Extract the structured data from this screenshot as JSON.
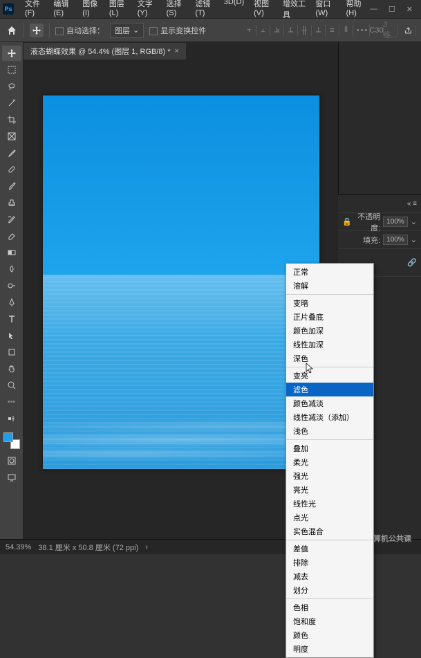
{
  "app": {
    "logo": "Ps"
  },
  "menu": [
    "文件(F)",
    "编辑(E)",
    "图像(I)",
    "图层(L)",
    "文字(Y)",
    "选择(S)",
    "滤镜(T)",
    "3D(D)",
    "视图(V)",
    "增效工具",
    "窗口(W)",
    "帮助(H)"
  ],
  "options": {
    "autoSelectLabel": "自动选择：",
    "targetDropdown": "图层",
    "showTransformLabel": "显示变换控件",
    "c30": "C30",
    "c30extra": "3维..."
  },
  "document": {
    "tabTitle": "液态蝴蝶效果 @ 54.4% (图层 1, RGB/8) *"
  },
  "panels": {
    "opacityLabel": "不透明度:",
    "opacityValue": "100%",
    "fillLabel": "填充:",
    "fillValue": "100%"
  },
  "blendModes": {
    "group1": [
      "正常",
      "溶解"
    ],
    "group2": [
      "变暗",
      "正片叠底",
      "颜色加深",
      "线性加深",
      "深色"
    ],
    "group3": [
      "变亮",
      "滤色",
      "颜色减淡",
      "线性减淡（添加）",
      "浅色"
    ],
    "group4": [
      "叠加",
      "柔光",
      "强光",
      "亮光",
      "线性光",
      "点光",
      "实色混合"
    ],
    "group5": [
      "差值",
      "排除",
      "减去",
      "划分"
    ],
    "group6": [
      "色相",
      "饱和度",
      "颜色",
      "明度"
    ],
    "highlighted": "滤色"
  },
  "status": {
    "zoom": "54.39%",
    "dims": "38.1 厘米 x 50.8 厘米 (72 ppi)"
  },
  "watermark": {
    "text": "计算机公共课"
  }
}
